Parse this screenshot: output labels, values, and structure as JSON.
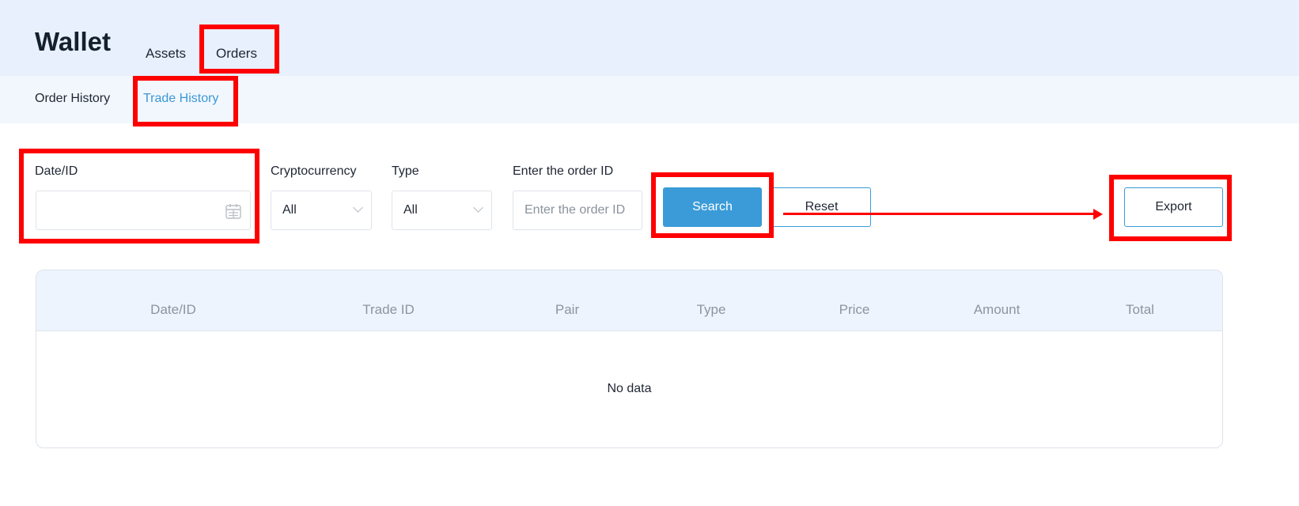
{
  "header": {
    "title": "Wallet",
    "tabs": [
      {
        "label": "Assets"
      },
      {
        "label": "Orders",
        "active": true
      }
    ]
  },
  "subnav": {
    "tabs": [
      {
        "label": "Order History"
      },
      {
        "label": "Trade History",
        "active": true
      }
    ]
  },
  "filters": {
    "date": {
      "label": "Date/ID",
      "value": ""
    },
    "crypto": {
      "label": "Cryptocurrency",
      "value": "All"
    },
    "type": {
      "label": "Type",
      "value": "All"
    },
    "order_id": {
      "label": "Enter the order ID",
      "placeholder": "Enter the order ID"
    }
  },
  "actions": {
    "search": "Search",
    "reset": "Reset",
    "export": "Export"
  },
  "table": {
    "columns": [
      "Date/ID",
      "Trade ID",
      "Pair",
      "Type",
      "Price",
      "Amount",
      "Total"
    ],
    "empty": "No data"
  },
  "icons": {
    "calendar": "calendar-icon",
    "chevron": "chevron-down-icon"
  },
  "colors": {
    "accent": "#3a9bd8",
    "annotation": "#ff0000",
    "header_bg": "#e8f0fd"
  }
}
